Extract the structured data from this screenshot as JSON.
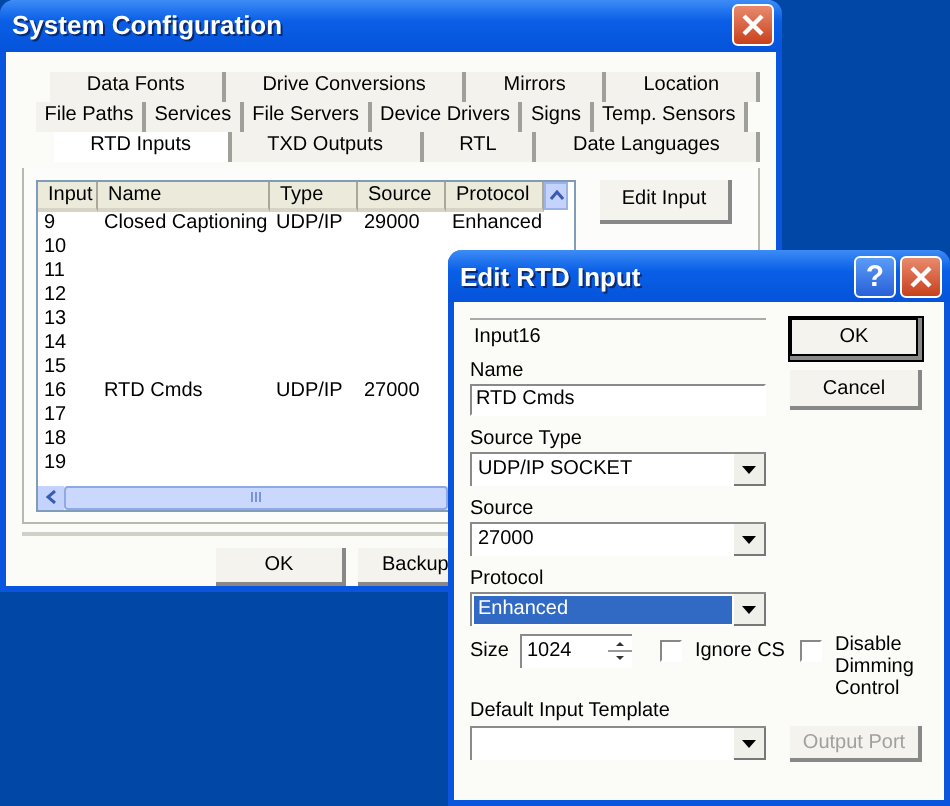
{
  "window": {
    "title": "System Configuration"
  },
  "tab_rows": [
    [
      {
        "label": "Data Fonts",
        "selected": false
      },
      {
        "label": "Drive Conversions",
        "selected": false
      },
      {
        "label": "Mirrors",
        "selected": false
      },
      {
        "label": "Location",
        "selected": false
      }
    ],
    [
      {
        "label": "File Paths",
        "selected": false
      },
      {
        "label": "Services",
        "selected": false
      },
      {
        "label": "File Servers",
        "selected": false
      },
      {
        "label": "Device Drivers",
        "selected": false
      },
      {
        "label": "Signs",
        "selected": false
      },
      {
        "label": "Temp. Sensors",
        "selected": false
      }
    ],
    [
      {
        "label": "RTD Inputs",
        "selected": true
      },
      {
        "label": "TXD Outputs",
        "selected": false
      },
      {
        "label": "RTL",
        "selected": false
      },
      {
        "label": "Date Languages",
        "selected": false
      }
    ]
  ],
  "table": {
    "columns": [
      "Input",
      "Name",
      "Type",
      "Source",
      "Protocol"
    ],
    "rows": [
      [
        "9",
        "Closed Captioning",
        "UDP/IP",
        "29000",
        "Enhanced"
      ],
      [
        "10"
      ],
      [
        "11"
      ],
      [
        "12"
      ],
      [
        "13"
      ],
      [
        "14"
      ],
      [
        "15"
      ],
      [
        "16",
        "RTD Cmds",
        "UDP/IP",
        "27000"
      ],
      [
        "17"
      ],
      [
        "18"
      ],
      [
        "19"
      ]
    ]
  },
  "edit_button": "Edit Input",
  "footer_buttons": [
    "OK",
    "Backup"
  ],
  "dialog": {
    "title": "Edit RTD Input",
    "help_button": "?",
    "input_id": "Input16",
    "name": {
      "label": "Name",
      "value": "RTD Cmds"
    },
    "combos": [
      {
        "label": "Source Type",
        "value": "UDP/IP SOCKET",
        "selected": false
      },
      {
        "label": "Source",
        "value": "27000",
        "selected": false
      },
      {
        "label": "Protocol",
        "value": "Enhanced",
        "selected": true
      }
    ],
    "size": {
      "label": "Size",
      "value": "1024"
    },
    "checkboxes": [
      {
        "label": "Ignore CS",
        "checked": false
      },
      {
        "label": "Disable Dimming Control",
        "checked": false
      }
    ],
    "template": {
      "label": "Default Input Template"
    },
    "buttons": [
      {
        "label": "OK",
        "default": true
      },
      {
        "label": "Cancel",
        "default": false
      }
    ],
    "output_button": {
      "label": "Output Port",
      "disabled": true
    }
  }
}
